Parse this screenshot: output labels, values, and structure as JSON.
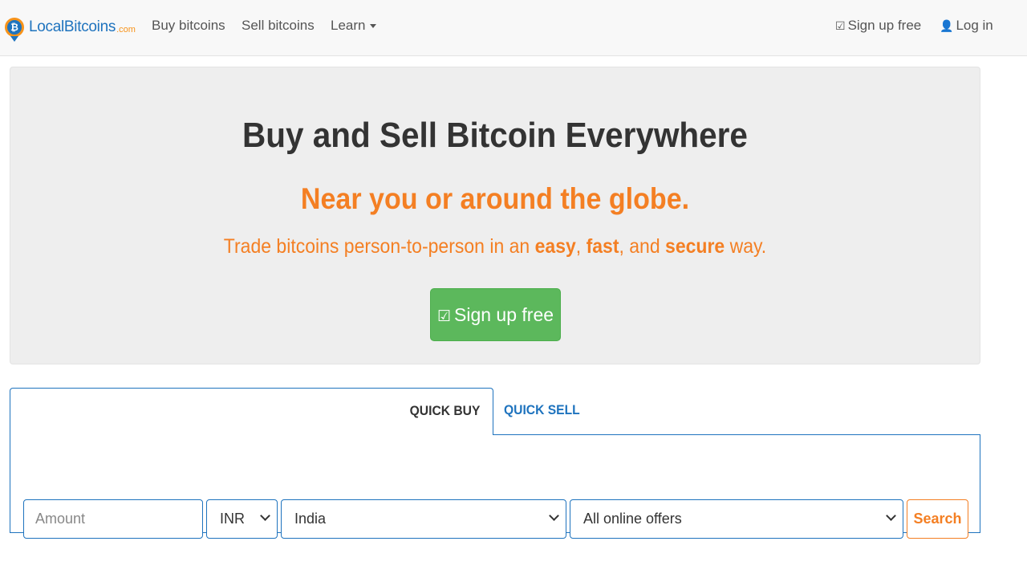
{
  "navbar": {
    "logo_text": "LocalBitcoins",
    "logo_suffix": ".com",
    "buy": "Buy bitcoins",
    "sell": "Sell bitcoins",
    "learn": "Learn",
    "signup": "Sign up free",
    "login": "Log in"
  },
  "hero": {
    "title": "Buy and Sell Bitcoin Everywhere",
    "subtitle": "Near you or around the globe.",
    "tagline_1": "Trade bitcoins person-to-person in an ",
    "tagline_easy": "easy",
    "tagline_2": ", ",
    "tagline_fast": "fast",
    "tagline_3": ", and ",
    "tagline_secure": "secure",
    "tagline_4": " way.",
    "button": "Sign up free"
  },
  "tabs": {
    "quick_buy": "QUICK BUY",
    "quick_sell": "QUICK SELL"
  },
  "search": {
    "amount_placeholder": "Amount",
    "currency": "INR",
    "country": "India",
    "offers": "All online offers",
    "button": "Search"
  },
  "colors": {
    "brand_blue": "#1e73be",
    "accent_orange": "#f47f23",
    "success_green": "#5cb85c"
  }
}
